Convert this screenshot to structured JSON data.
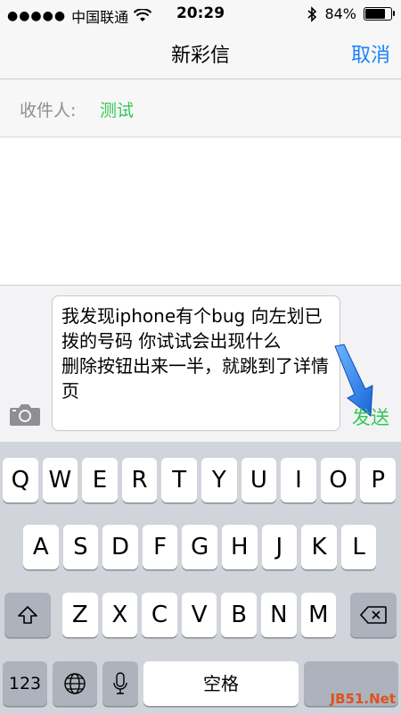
{
  "status": {
    "carrier": "中国联通",
    "time": "20:29",
    "battery_label": "84%",
    "battery_level": 0.84
  },
  "nav": {
    "title": "新彩信",
    "cancel_label": "取消"
  },
  "recipient": {
    "label": "收件人:",
    "name": "测试"
  },
  "compose": {
    "message": "我发现iphone有个bug 向左划已拨的号码 你试试会出现什么\n删除按钮出来一半，就跳到了详情页",
    "send_label": "发送"
  },
  "keyboard": {
    "row1": [
      "Q",
      "W",
      "E",
      "R",
      "T",
      "Y",
      "U",
      "I",
      "O",
      "P"
    ],
    "row2": [
      "A",
      "S",
      "D",
      "F",
      "G",
      "H",
      "J",
      "K",
      "L"
    ],
    "row3": [
      "Z",
      "X",
      "C",
      "V",
      "B",
      "N",
      "M"
    ],
    "numbers_label": "123",
    "space_label": "空格"
  },
  "colors": {
    "accent_blue": "#1a82fb",
    "green": "#34c759"
  }
}
